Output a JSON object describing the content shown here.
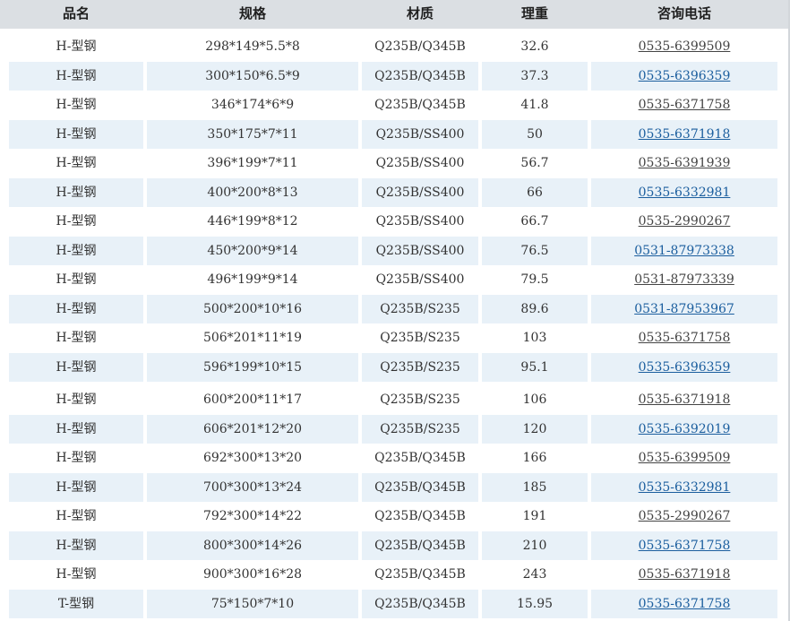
{
  "header": {
    "name": "品名",
    "spec": "规格",
    "material": "材质",
    "weight": "理重",
    "phone": "咨询电话"
  },
  "rows": [
    {
      "name": "H-型钢",
      "spec": "298*149*5.5*8",
      "material": "Q235B/Q345B",
      "weight": "32.6",
      "phone": "0535-6399509"
    },
    {
      "name": "H-型钢",
      "spec": "300*150*6.5*9",
      "material": "Q235B/Q345B",
      "weight": "37.3",
      "phone": "0535-6396359"
    },
    {
      "name": "H-型钢",
      "spec": "346*174*6*9",
      "material": "Q235B/Q345B",
      "weight": "41.8",
      "phone": "0535-6371758"
    },
    {
      "name": "H-型钢",
      "spec": "350*175*7*11",
      "material": "Q235B/SS400",
      "weight": "50",
      "phone": "0535-6371918"
    },
    {
      "name": "H-型钢",
      "spec": "396*199*7*11",
      "material": "Q235B/SS400",
      "weight": "56.7",
      "phone": "0535-6391939"
    },
    {
      "name": "H-型钢",
      "spec": "400*200*8*13",
      "material": "Q235B/SS400",
      "weight": "66",
      "phone": "0535-6332981"
    },
    {
      "name": "H-型钢",
      "spec": "446*199*8*12",
      "material": "Q235B/SS400",
      "weight": "66.7",
      "phone": "0535-2990267"
    },
    {
      "name": "H-型钢",
      "spec": "450*200*9*14",
      "material": "Q235B/SS400",
      "weight": "76.5",
      "phone": "0531-87973338"
    },
    {
      "name": "H-型钢",
      "spec": "496*199*9*14",
      "material": "Q235B/SS400",
      "weight": "79.5",
      "phone": "0531-87973339"
    },
    {
      "name": "H-型钢",
      "spec": "500*200*10*16",
      "material": "Q235B/S235",
      "weight": "89.6",
      "phone": "0531-87953967"
    },
    {
      "name": "H-型钢",
      "spec": "506*201*11*19",
      "material": "Q235B/S235",
      "weight": "103",
      "phone": "0535-6371758"
    },
    {
      "name": "H-型钢",
      "spec": "596*199*10*15",
      "material": "Q235B/S235",
      "weight": "95.1",
      "phone": "0535-6396359"
    },
    {
      "name": "H-型钢",
      "spec": "600*200*11*17",
      "material": "Q235B/S235",
      "weight": "106",
      "phone": "0535-6371918"
    },
    {
      "name": "H-型钢",
      "spec": "606*201*12*20",
      "material": "Q235B/S235",
      "weight": "120",
      "phone": "0535-6392019"
    },
    {
      "name": "H-型钢",
      "spec": "692*300*13*20",
      "material": "Q235B/Q345B",
      "weight": "166",
      "phone": "0535-6399509"
    },
    {
      "name": "H-型钢",
      "spec": "700*300*13*24",
      "material": "Q235B/Q345B",
      "weight": "185",
      "phone": "0535-6332981"
    },
    {
      "name": "H-型钢",
      "spec": "792*300*14*22",
      "material": "Q235B/Q345B",
      "weight": "191",
      "phone": "0535-2990267"
    },
    {
      "name": "H-型钢",
      "spec": "800*300*14*26",
      "material": "Q235B/Q345B",
      "weight": "210",
      "phone": "0535-6371758"
    },
    {
      "name": "H-型钢",
      "spec": "900*300*16*28",
      "material": "Q235B/Q345B",
      "weight": "243",
      "phone": "0535-6371918"
    },
    {
      "name": "T-型钢",
      "spec": "75*150*7*10",
      "material": "Q235B/Q345B",
      "weight": "15.95",
      "phone": "0535-6371758"
    }
  ]
}
